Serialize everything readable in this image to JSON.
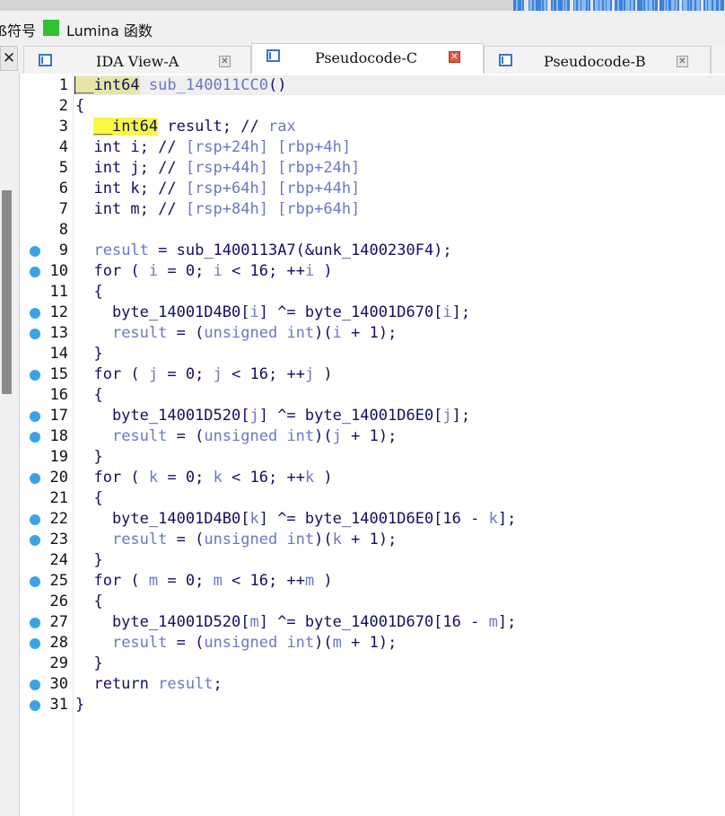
{
  "legend": {
    "symbol_label": "ß符号",
    "lumina_label": "Lumina 函数",
    "lumina_color": "#2ec22e"
  },
  "tabs": [
    {
      "label": "IDA View-A",
      "icon": "pseudocode-window-icon",
      "active": false
    },
    {
      "label": "Pseudocode-C",
      "icon": "pseudocode-window-icon",
      "active": true
    },
    {
      "label": "Pseudocode-B",
      "icon": "pseudocode-window-icon",
      "active": false
    }
  ],
  "close_glyph": "✕",
  "tab_close_glyph": "✕",
  "colors": {
    "breakpoint_dot": "#3aa3e6",
    "highlight": "#f8f845",
    "variable": "#6a78c8",
    "code_text": "#101060"
  },
  "code": {
    "lines": [
      {
        "n": "1",
        "bp": false,
        "parts": [
          [
            "hls",
            "__int64"
          ],
          [
            "v",
            " sub_140011CC0"
          ],
          [
            "k",
            "()"
          ]
        ]
      },
      {
        "n": "2",
        "bp": false,
        "parts": [
          [
            "k",
            "{"
          ]
        ]
      },
      {
        "n": "3",
        "bp": false,
        "parts": [
          [
            "k",
            "  "
          ],
          [
            "hl",
            "__int64"
          ],
          [
            "k",
            " result; // "
          ],
          [
            "v",
            "rax"
          ]
        ]
      },
      {
        "n": "4",
        "bp": false,
        "parts": [
          [
            "k",
            "  int i; // "
          ],
          [
            "v",
            "[rsp+24h] [rbp+4h]"
          ]
        ]
      },
      {
        "n": "5",
        "bp": false,
        "parts": [
          [
            "k",
            "  int j; // "
          ],
          [
            "v",
            "[rsp+44h] [rbp+24h]"
          ]
        ]
      },
      {
        "n": "6",
        "bp": false,
        "parts": [
          [
            "k",
            "  int k; // "
          ],
          [
            "v",
            "[rsp+64h] [rbp+44h]"
          ]
        ]
      },
      {
        "n": "7",
        "bp": false,
        "parts": [
          [
            "k",
            "  int m; // "
          ],
          [
            "v",
            "[rsp+84h] [rbp+64h]"
          ]
        ]
      },
      {
        "n": "8",
        "bp": false,
        "parts": []
      },
      {
        "n": "9",
        "bp": true,
        "parts": [
          [
            "k",
            "  "
          ],
          [
            "v",
            "result"
          ],
          [
            "k",
            " = sub_1400113A7(&unk_1400230F4);"
          ]
        ]
      },
      {
        "n": "10",
        "bp": true,
        "parts": [
          [
            "k",
            "  for ( "
          ],
          [
            "v",
            "i"
          ],
          [
            "k",
            " = 0; "
          ],
          [
            "v",
            "i"
          ],
          [
            "k",
            " < 16; ++"
          ],
          [
            "v",
            "i"
          ],
          [
            "k",
            " )"
          ]
        ]
      },
      {
        "n": "11",
        "bp": false,
        "parts": [
          [
            "k",
            "  {"
          ]
        ]
      },
      {
        "n": "12",
        "bp": true,
        "parts": [
          [
            "k",
            "    byte_14001D4B0["
          ],
          [
            "v",
            "i"
          ],
          [
            "k",
            "] ^= byte_14001D670["
          ],
          [
            "v",
            "i"
          ],
          [
            "k",
            "];"
          ]
        ]
      },
      {
        "n": "13",
        "bp": true,
        "parts": [
          [
            "k",
            "    "
          ],
          [
            "v",
            "result"
          ],
          [
            "k",
            " = ("
          ],
          [
            "v",
            "unsigned int"
          ],
          [
            "k",
            ")("
          ],
          [
            "v",
            "i"
          ],
          [
            "k",
            " + 1);"
          ]
        ]
      },
      {
        "n": "14",
        "bp": false,
        "parts": [
          [
            "k",
            "  }"
          ]
        ]
      },
      {
        "n": "15",
        "bp": true,
        "parts": [
          [
            "k",
            "  for ( "
          ],
          [
            "v",
            "j"
          ],
          [
            "k",
            " = 0; "
          ],
          [
            "v",
            "j"
          ],
          [
            "k",
            " < 16; ++"
          ],
          [
            "v",
            "j"
          ],
          [
            "k",
            " )"
          ]
        ]
      },
      {
        "n": "16",
        "bp": false,
        "parts": [
          [
            "k",
            "  {"
          ]
        ]
      },
      {
        "n": "17",
        "bp": true,
        "parts": [
          [
            "k",
            "    byte_14001D520["
          ],
          [
            "v",
            "j"
          ],
          [
            "k",
            "] ^= byte_14001D6E0["
          ],
          [
            "v",
            "j"
          ],
          [
            "k",
            "];"
          ]
        ]
      },
      {
        "n": "18",
        "bp": true,
        "parts": [
          [
            "k",
            "    "
          ],
          [
            "v",
            "result"
          ],
          [
            "k",
            " = ("
          ],
          [
            "v",
            "unsigned int"
          ],
          [
            "k",
            ")("
          ],
          [
            "v",
            "j"
          ],
          [
            "k",
            " + 1);"
          ]
        ]
      },
      {
        "n": "19",
        "bp": false,
        "parts": [
          [
            "k",
            "  }"
          ]
        ]
      },
      {
        "n": "20",
        "bp": true,
        "parts": [
          [
            "k",
            "  for ( "
          ],
          [
            "v",
            "k"
          ],
          [
            "k",
            " = 0; "
          ],
          [
            "v",
            "k"
          ],
          [
            "k",
            " < 16; ++"
          ],
          [
            "v",
            "k"
          ],
          [
            "k",
            " )"
          ]
        ]
      },
      {
        "n": "21",
        "bp": false,
        "parts": [
          [
            "k",
            "  {"
          ]
        ]
      },
      {
        "n": "22",
        "bp": true,
        "parts": [
          [
            "k",
            "    byte_14001D4B0["
          ],
          [
            "v",
            "k"
          ],
          [
            "k",
            "] ^= byte_14001D6E0[16 - "
          ],
          [
            "v",
            "k"
          ],
          [
            "k",
            "];"
          ]
        ]
      },
      {
        "n": "23",
        "bp": true,
        "parts": [
          [
            "k",
            "    "
          ],
          [
            "v",
            "result"
          ],
          [
            "k",
            " = ("
          ],
          [
            "v",
            "unsigned int"
          ],
          [
            "k",
            ")("
          ],
          [
            "v",
            "k"
          ],
          [
            "k",
            " + 1);"
          ]
        ]
      },
      {
        "n": "24",
        "bp": false,
        "parts": [
          [
            "k",
            "  }"
          ]
        ]
      },
      {
        "n": "25",
        "bp": true,
        "parts": [
          [
            "k",
            "  for ( "
          ],
          [
            "v",
            "m"
          ],
          [
            "k",
            " = 0; "
          ],
          [
            "v",
            "m"
          ],
          [
            "k",
            " < 16; ++"
          ],
          [
            "v",
            "m"
          ],
          [
            "k",
            " )"
          ]
        ]
      },
      {
        "n": "26",
        "bp": false,
        "parts": [
          [
            "k",
            "  {"
          ]
        ]
      },
      {
        "n": "27",
        "bp": true,
        "parts": [
          [
            "k",
            "    byte_14001D520["
          ],
          [
            "v",
            "m"
          ],
          [
            "k",
            "] ^= byte_14001D670[16 - "
          ],
          [
            "v",
            "m"
          ],
          [
            "k",
            "];"
          ]
        ]
      },
      {
        "n": "28",
        "bp": true,
        "parts": [
          [
            "k",
            "    "
          ],
          [
            "v",
            "result"
          ],
          [
            "k",
            " = ("
          ],
          [
            "v",
            "unsigned int"
          ],
          [
            "k",
            ")("
          ],
          [
            "v",
            "m"
          ],
          [
            "k",
            " + 1);"
          ]
        ]
      },
      {
        "n": "29",
        "bp": false,
        "parts": [
          [
            "k",
            "  }"
          ]
        ]
      },
      {
        "n": "30",
        "bp": true,
        "parts": [
          [
            "k",
            "  return "
          ],
          [
            "v",
            "result"
          ],
          [
            "k",
            ";"
          ]
        ]
      },
      {
        "n": "31",
        "bp": true,
        "parts": [
          [
            "k",
            "}"
          ]
        ]
      }
    ]
  }
}
